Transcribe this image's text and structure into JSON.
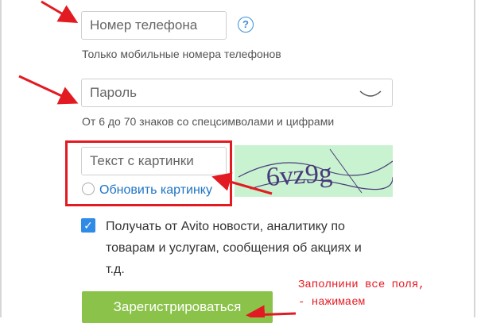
{
  "form": {
    "phone_placeholder": "Номер телефона",
    "phone_hint": "Только мобильные номера телефонов",
    "password_placeholder": "Пароль",
    "password_hint": "От 6 до 70 знаков со спецсимволами и цифрами",
    "captcha_placeholder": "Текст с картинки",
    "captcha_text": "6vz9g",
    "refresh_label": "Обновить картинку",
    "subscribe_checked": true,
    "subscribe_line1": "Получать от Avito новости, аналитику по",
    "subscribe_line2": "товарам и услугам, сообщения об акциях и",
    "subscribe_line3": "т.д.",
    "register_button": "Зарегистрироваться",
    "help_icon": "question-icon",
    "password_toggle_icon": "eye-icon"
  },
  "annotation": {
    "note_line1": "Заполнини все поля,",
    "note_line2": "- нажимаем",
    "color": "#e21b22"
  }
}
